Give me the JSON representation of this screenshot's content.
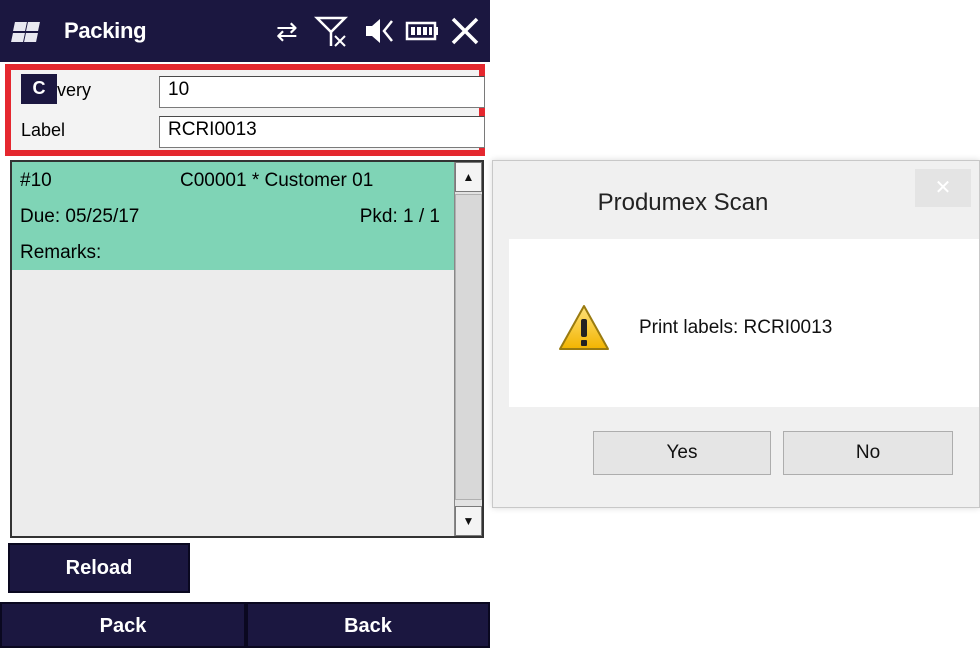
{
  "app": {
    "title": "Packing",
    "tray_icons": [
      "sync-arrows-icon",
      "no-signal-icon",
      "volume-icon",
      "battery-icon",
      "close-icon"
    ],
    "tray_glyphs": [
      "⇄",
      "⚲",
      "◁",
      "▭",
      "✕"
    ],
    "colors": {
      "titlebar": "#1b1740",
      "highlight_border": "#e5282f",
      "list_selected": "#7fd4b6"
    }
  },
  "form": {
    "badge": "C",
    "delivery_label": "very",
    "delivery_value": "10",
    "label_label": "Label",
    "label_value": "RCRI0013"
  },
  "list": {
    "items": [
      {
        "doc": "#10",
        "customer": "C00001 * Customer 01",
        "due": "Due: 05/25/17",
        "packed": "Pkd: 1 / 1",
        "remarks": "Remarks:"
      }
    ]
  },
  "buttons": {
    "reload": "Reload",
    "pack": "Pack",
    "back": "Back"
  },
  "dialog": {
    "title": "Produmex Scan",
    "close": "✕",
    "message": "Print labels: RCRI0013",
    "yes": "Yes",
    "no": "No"
  }
}
